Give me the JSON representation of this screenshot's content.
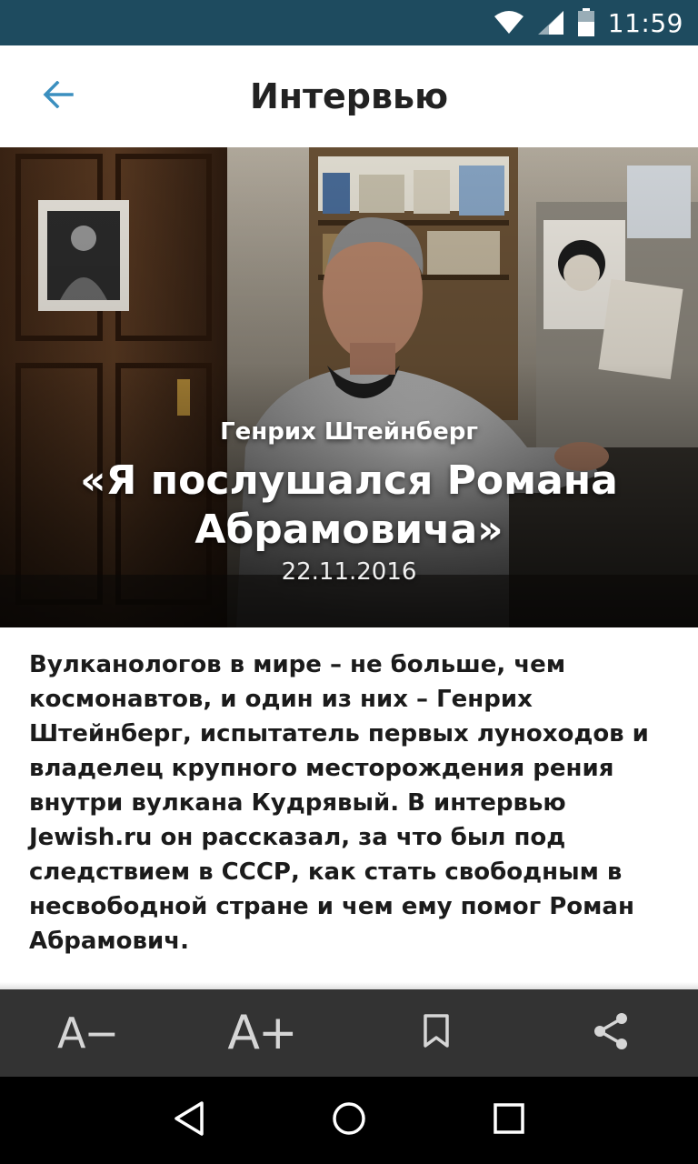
{
  "status_bar": {
    "time": "11:59",
    "icons": [
      "wifi-icon",
      "signal-icon",
      "battery-icon"
    ],
    "background": "#1e4b5f"
  },
  "app_bar": {
    "title": "Интервью",
    "back_icon": "arrow-back-icon",
    "accent": "#3b8fbf"
  },
  "article": {
    "author": "Генрих Штейнберг",
    "title": "«Я послушался Романа Абрамовича»",
    "date": "22.11.2016",
    "lead": "Вулканологов в мире – не больше, чем космонавтов, и один из них – Генрих Штейнберг, испытатель первых луноходов и владелец крупного месторождения рения внутри вулкана Кудрявый. В интервью Jewish.ru он рассказал, за что был под следствием в СССР, как стать свободным в несвободной стране и чем ему помог Роман Абрамович."
  },
  "toolbar": {
    "decrease_font_label": "A−",
    "increase_font_label": "A+",
    "bookmark_icon": "bookmark-icon",
    "share_icon": "share-icon",
    "background": "#333333"
  },
  "nav_bar": {
    "buttons": [
      "back-triangle-icon",
      "home-circle-icon",
      "recents-square-icon"
    ]
  }
}
